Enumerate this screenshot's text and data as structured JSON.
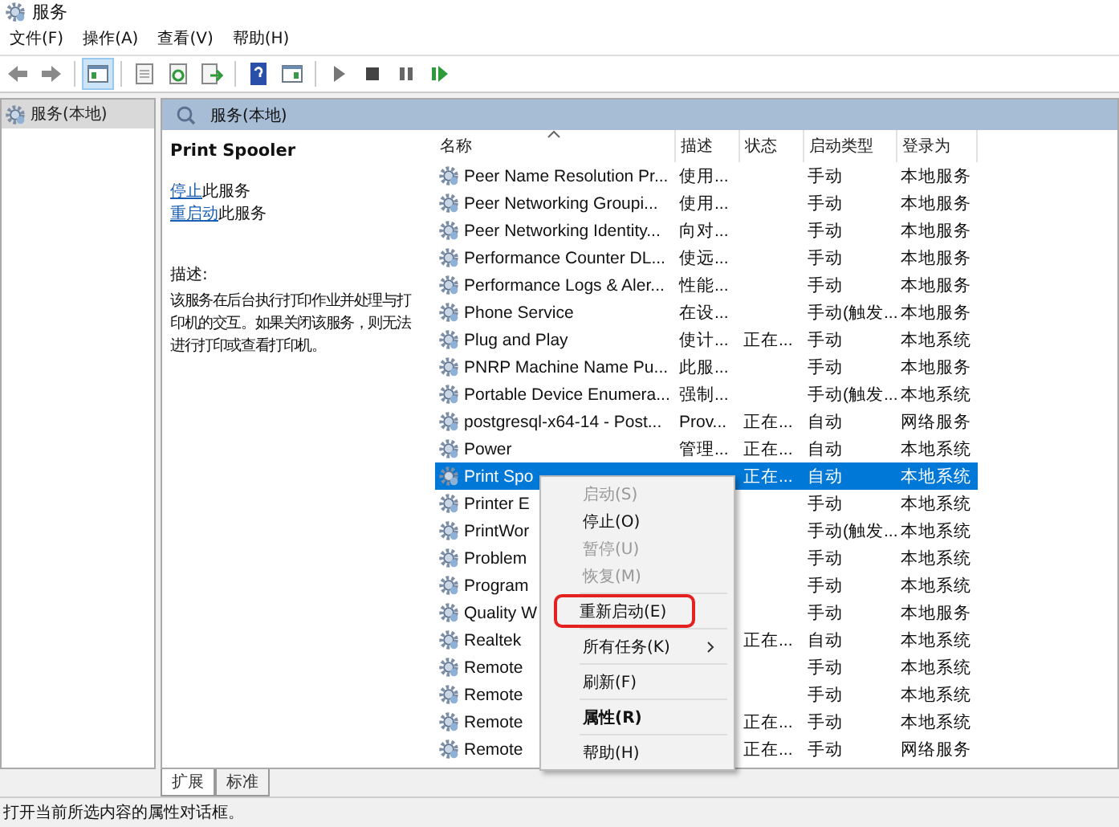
{
  "window": {
    "title": "服务"
  },
  "menu": [
    "文件(F)",
    "操作(A)",
    "查看(V)",
    "帮助(H)"
  ],
  "tree": {
    "items": [
      {
        "label": "服务(本地)",
        "selected": true
      }
    ]
  },
  "panel": {
    "header": "服务(本地)",
    "service_name": "Print Spooler",
    "actions": [
      {
        "link": "停止",
        "text": "此服务"
      },
      {
        "link": "重启动",
        "text": "此服务"
      }
    ],
    "description_label": "描述:",
    "description": "该服务在后台执行打印作业并处理与打印机的交互。如果关闭该服务，则无法进行打印或查看打印机。"
  },
  "table": {
    "columns": [
      "名称",
      "描述",
      "状态",
      "启动类型",
      "登录为"
    ],
    "rows": [
      {
        "name": "Peer Name Resolution Pr...",
        "description": "使用...",
        "startup": "手动",
        "logon": "本地服务",
        "selected": false
      },
      {
        "name": "Peer Networking Groupi...",
        "description": "使用...",
        "startup": "手动",
        "logon": "本地服务",
        "selected": false
      },
      {
        "name": "Peer Networking Identity...",
        "description": "向对...",
        "startup": "手动",
        "logon": "本地服务",
        "selected": false
      },
      {
        "name": "Performance Counter DL...",
        "description": "使远...",
        "startup": "手动",
        "logon": "本地服务",
        "selected": false
      },
      {
        "name": "Performance Logs & Aler...",
        "description": "性能...",
        "startup": "手动",
        "logon": "本地服务",
        "selected": false
      },
      {
        "name": "Phone Service",
        "description": "在设...",
        "startup": "手动(触发...",
        "logon": "本地服务",
        "selected": false
      },
      {
        "name": "Plug and Play",
        "description": "使计...",
        "status": "正在...",
        "startup": "手动",
        "logon": "本地系统",
        "selected": false
      },
      {
        "name": "PNRP Machine Name Pu...",
        "description": "此服...",
        "startup": "手动",
        "logon": "本地服务",
        "selected": false
      },
      {
        "name": "Portable Device Enumera...",
        "description": "强制...",
        "startup": "手动(触发...",
        "logon": "本地系统",
        "selected": false
      },
      {
        "name": "postgresql-x64-14 - Post...",
        "description": "Prov...",
        "status": "正在...",
        "startup": "自动",
        "logon": "网络服务",
        "selected": false
      },
      {
        "name": "Power",
        "description": "管理...",
        "status": "正在...",
        "startup": "自动",
        "logon": "本地系统",
        "selected": false
      },
      {
        "name": "Print Spo",
        "status": "正在...",
        "startup": "自动",
        "logon": "本地系统",
        "selected": true
      },
      {
        "name": "Printer E",
        "startup": "手动",
        "logon": "本地系统",
        "selected": false
      },
      {
        "name": "PrintWor",
        "startup": "手动(触发...",
        "logon": "本地系统",
        "selected": false
      },
      {
        "name": "Problem",
        "startup": "手动",
        "logon": "本地系统",
        "selected": false
      },
      {
        "name": "Program",
        "startup": "手动",
        "logon": "本地系统",
        "selected": false
      },
      {
        "name": "Quality W",
        "startup": "手动",
        "logon": "本地服务",
        "selected": false
      },
      {
        "name": "Realtek",
        "status": "正在...",
        "startup": "自动",
        "logon": "本地系统",
        "selected": false
      },
      {
        "name": "Remote",
        "startup": "手动",
        "logon": "本地系统",
        "selected": false
      },
      {
        "name": "Remote",
        "startup": "手动",
        "logon": "本地系统",
        "selected": false
      },
      {
        "name": "Remote",
        "status": "正在...",
        "startup": "手动",
        "logon": "本地系统",
        "selected": false
      },
      {
        "name": "Remote",
        "status": "正在...",
        "startup": "手动",
        "logon": "网络服务",
        "selected": false
      }
    ]
  },
  "context_menu": [
    {
      "kind": "item",
      "label": "启动(S)",
      "disabled": true
    },
    {
      "kind": "item",
      "label": "停止(O)",
      "disabled": false
    },
    {
      "kind": "item",
      "label": "暂停(U)",
      "disabled": true
    },
    {
      "kind": "item",
      "label": "恢复(M)",
      "disabled": true
    },
    {
      "kind": "separator"
    },
    {
      "kind": "item",
      "label": "重新启动(E)",
      "disabled": false,
      "outlined": true
    },
    {
      "kind": "separator"
    },
    {
      "kind": "submenu",
      "label": "所有任务(K)",
      "disabled": false
    },
    {
      "kind": "separator"
    },
    {
      "kind": "item",
      "label": "刷新(F)",
      "disabled": false
    },
    {
      "kind": "separator"
    },
    {
      "kind": "item",
      "label": "属性(R)",
      "disabled": false,
      "bold": true
    },
    {
      "kind": "separator"
    },
    {
      "kind": "item",
      "label": "帮助(H)",
      "disabled": false
    }
  ],
  "tabs": [
    {
      "label": "扩展",
      "selected": true
    },
    {
      "label": "标准",
      "selected": false
    }
  ],
  "status_bar": "打开当前所选内容的属性对话框。"
}
